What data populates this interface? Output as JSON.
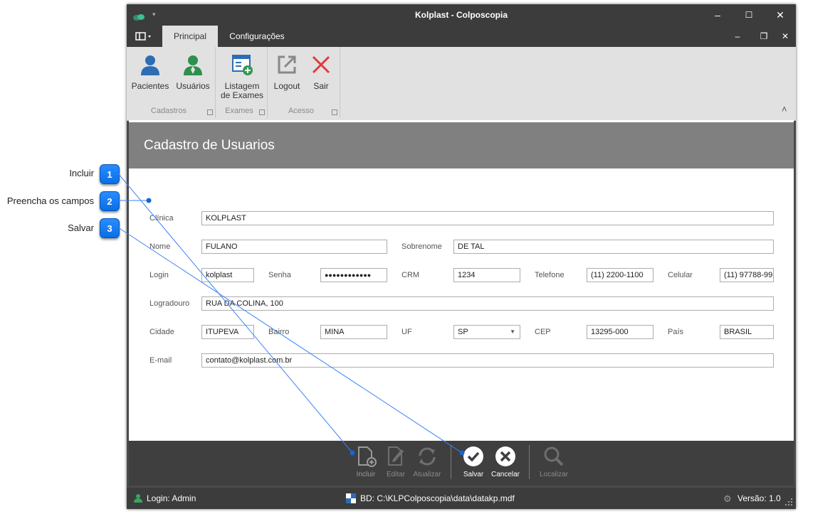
{
  "callouts": [
    {
      "label": "Incluir",
      "number": "1"
    },
    {
      "label": "Preencha os campos",
      "number": "2"
    },
    {
      "label": "Salvar",
      "number": "3"
    }
  ],
  "window": {
    "title": "Kolplast - Colposcopia",
    "controls": {
      "minimize": "–",
      "maximize": "☐",
      "close": "✕",
      "restore": "❐"
    }
  },
  "tabs": [
    {
      "label": "Principal",
      "active": true
    },
    {
      "label": "Configurações",
      "active": false
    }
  ],
  "ribbon": {
    "groups": [
      {
        "label": "Cadastros",
        "buttons": [
          {
            "label": "Pacientes",
            "icon": "person-blue-icon"
          },
          {
            "label": "Usuários",
            "icon": "person-green-icon"
          }
        ]
      },
      {
        "label": "Exames",
        "buttons": [
          {
            "label": "Listagem de Exames",
            "icon": "list-add-icon"
          }
        ]
      },
      {
        "label": "Acesso",
        "buttons": [
          {
            "label": "Logout",
            "icon": "logout-icon"
          },
          {
            "label": "Sair",
            "icon": "close-red-icon"
          }
        ]
      }
    ],
    "collapse": "˄"
  },
  "form": {
    "title": "Cadastro de Usuarios",
    "fields": {
      "clinica": {
        "label": "Clínica",
        "value": "KOLPLAST"
      },
      "nome": {
        "label": "Nome",
        "value": "FULANO"
      },
      "sobrenome": {
        "label": "Sobrenome",
        "value": "DE TAL"
      },
      "login": {
        "label": "Login",
        "value": "kolplast"
      },
      "senha": {
        "label": "Senha",
        "value": "●●●●●●●●●●●●"
      },
      "crm": {
        "label": "CRM",
        "value": "1234"
      },
      "telefone": {
        "label": "Telefone",
        "value": "(11) 2200-1100"
      },
      "celular": {
        "label": "Celular",
        "value": "(11) 97788-99"
      },
      "logradouro": {
        "label": "Logradouro",
        "value": "RUA DA COLINA, 100"
      },
      "cidade": {
        "label": "Cidade",
        "value": "ITUPEVA"
      },
      "bairro": {
        "label": "Bairro",
        "value": "MINA"
      },
      "uf": {
        "label": "UF",
        "value": "SP"
      },
      "cep": {
        "label": "CEP",
        "value": "13295-000"
      },
      "pais": {
        "label": "País",
        "value": "BRASIL"
      },
      "email": {
        "label": "E-mail",
        "value": "contato@kolplast.com.br"
      }
    }
  },
  "toolbar": {
    "incluir": "Incluir",
    "editar": "Editar",
    "atualizar": "Atualizar",
    "salvar": "Salvar",
    "cancelar": "Cancelar",
    "localizar": "Localizar"
  },
  "status": {
    "login": "Login: Admin",
    "db": "BD: C:\\KLPColposcopia\\data\\datakp.mdf",
    "version": "Versão: 1.0"
  },
  "colors": {
    "accent": "#0a6ee6",
    "titlebar": "#3c3c3c",
    "header": "#808080"
  }
}
